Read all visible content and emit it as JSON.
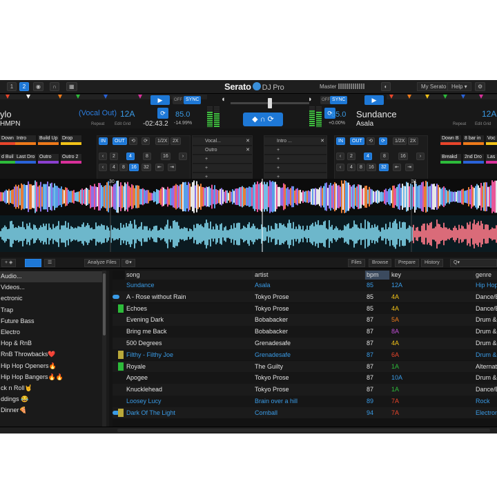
{
  "app": {
    "brand": "Serato",
    "product": "DJ Pro"
  },
  "topbar": {
    "left_buttons": [
      "1",
      "2"
    ],
    "master_label": "Master",
    "right_links": [
      "My Serato",
      "Help ▾"
    ]
  },
  "deck_left": {
    "title": "ylo",
    "artist": "HMPN",
    "vocal_label": "(Vocal Out)",
    "key": "12A",
    "time": "-02:43.2",
    "bpm": "85.0",
    "pitch": "-14.99%",
    "repeat": "Repeat",
    "edit_grid": "Edit Grid",
    "play": "▶",
    "sync": "SYNC",
    "off": "OFF",
    "level": 0.75
  },
  "deck_right": {
    "title": "Sundance",
    "artist": "Asala",
    "key": "12A",
    "bpm": "85.0",
    "pitch": "+0.00%",
    "repeat": "Repeat",
    "edit_grid": "Edit Grid",
    "play": "▶",
    "sync": "SYNC",
    "off": "OFF",
    "level": 0.8
  },
  "pads_left": [
    {
      "label": "Down B",
      "color": "#e8452b"
    },
    {
      "label": "Intro",
      "color": "#ee7a1a"
    },
    {
      "label": "Build Up",
      "color": "#ee7a1a"
    },
    {
      "label": "Drop",
      "color": "#f2c318"
    },
    {
      "label": "d Buil",
      "color": "#2dbb3a"
    },
    {
      "label": "Last Dro",
      "color": "#2a62d8"
    },
    {
      "label": "Outro",
      "color": "#8a3fcf"
    },
    {
      "label": "Outro 2",
      "color": "#d8309a"
    }
  ],
  "pads_right": [
    {
      "label": "Down B",
      "color": "#e8452b"
    },
    {
      "label": "8 bar in",
      "color": "#ee7a1a"
    },
    {
      "label": "Voc",
      "color": "#f2c318"
    },
    {
      "label": "Breakd",
      "color": "#2dbb3a"
    },
    {
      "label": "2nd Dro",
      "color": "#2a62d8"
    },
    {
      "label": "Las",
      "color": "#d8309a"
    }
  ],
  "loops_left": {
    "in": "IN",
    "out": "OUT",
    "half": "1/2X",
    "double": "2X",
    "row1": [
      "2",
      "4",
      "8",
      "16"
    ],
    "row2": [
      "4",
      "8",
      "16",
      "32"
    ]
  },
  "loops_right": {
    "in": "IN",
    "out": "OUT",
    "half": "1/2X",
    "double": "2X",
    "row1": [
      "2",
      "4",
      "8",
      "16"
    ],
    "row2": [
      "4",
      "8",
      "16",
      "32"
    ]
  },
  "fx_left": [
    "Vocal...",
    "Outro"
  ],
  "fx_right": [
    "Intro ..."
  ],
  "waveform": {
    "marker_left": "30",
    "marker_right": "31"
  },
  "library": {
    "analyze": "Analyze Files",
    "tabs": [
      "Files",
      "Browse",
      "Prepare",
      "History"
    ],
    "search_placeholder": "Q▾"
  },
  "crates": [
    "Audio...",
    "Videos...",
    "ectronic",
    "Trap",
    "Future Bass",
    "Electro",
    "Hop & RnB",
    "RnB Throwbacks❤️",
    "Hip Hop Openers🔥",
    "Hip Hop Bangers🔥🔥",
    "ck n Roll🤘",
    "ddings 😂",
    "Dinner🍕"
  ],
  "columns": [
    "song",
    "artist",
    "bpm",
    "key",
    "genre"
  ],
  "tracks": [
    {
      "song": "Sundance",
      "artist": "Asala",
      "bpm": "85",
      "key": "12A",
      "genre": "Hip Hop",
      "text_color": "#3a9be6",
      "key_color": "#3a9be6",
      "mark": "",
      "playing": false
    },
    {
      "song": "A - Rose without Rain",
      "artist": "Tokyo Prose",
      "bpm": "85",
      "key": "4A",
      "genre": "Dance/E",
      "text_color": "#e2e2e2",
      "key_color": "#f2c318",
      "mark": "",
      "playing": true
    },
    {
      "song": "Echoes",
      "artist": "Tokyo Prose",
      "bpm": "85",
      "key": "4A",
      "genre": "Dance/E",
      "text_color": "#e2e2e2",
      "key_color": "#f2c318",
      "mark": "#2dbb3a",
      "playing": false
    },
    {
      "song": "Evening Dark",
      "artist": "Bobabacker",
      "bpm": "87",
      "key": "5A",
      "genre": "Drum &",
      "text_color": "#e2e2e2",
      "key_color": "#ee7a1a",
      "mark": "",
      "playing": false
    },
    {
      "song": "Bring me Back",
      "artist": "Bobabacker",
      "bpm": "87",
      "key": "8A",
      "genre": "Drum &",
      "text_color": "#e2e2e2",
      "key_color": "#c24fd8",
      "mark": "",
      "playing": false
    },
    {
      "song": "500 Degrees",
      "artist": "Grenadesafe",
      "bpm": "87",
      "key": "4A",
      "genre": "Drum &",
      "text_color": "#e2e2e2",
      "key_color": "#f2c318",
      "mark": "",
      "playing": false
    },
    {
      "song": "Filthy - Filthy Joe",
      "artist": "Grenadesafe",
      "bpm": "87",
      "key": "6A",
      "genre": "Drum &",
      "text_color": "#3a9be6",
      "key_color": "#e8452b",
      "mark": "#b9a93a",
      "playing": false
    },
    {
      "song": "Royale",
      "artist": "The Guilty",
      "bpm": "87",
      "key": "1A",
      "genre": "Alternat",
      "text_color": "#e2e2e2",
      "key_color": "#2dbb3a",
      "mark": "#2dbb3a",
      "playing": false
    },
    {
      "song": "Apogee",
      "artist": "Tokyo Prose",
      "bpm": "87",
      "key": "10A",
      "genre": "Drum &",
      "text_color": "#e2e2e2",
      "key_color": "#3a9be6",
      "mark": "",
      "playing": false
    },
    {
      "song": "Knucklehead",
      "artist": "Tokyo Prose",
      "bpm": "87",
      "key": "1A",
      "genre": "Dance/E",
      "text_color": "#e2e2e2",
      "key_color": "#2dbb3a",
      "mark": "",
      "playing": false
    },
    {
      "song": "Loosey Lucy",
      "artist": "Brain over a hill",
      "bpm": "89",
      "key": "7A",
      "genre": "Rock",
      "text_color": "#3a9be6",
      "key_color": "#e8452b",
      "mark": "",
      "playing": false
    },
    {
      "song": "Dark Of The Light",
      "artist": "Comball",
      "bpm": "94",
      "key": "7A",
      "genre": "Electron",
      "text_color": "#3a9be6",
      "key_color": "#e8452b",
      "mark": "#b9a93a",
      "playing": true
    }
  ]
}
